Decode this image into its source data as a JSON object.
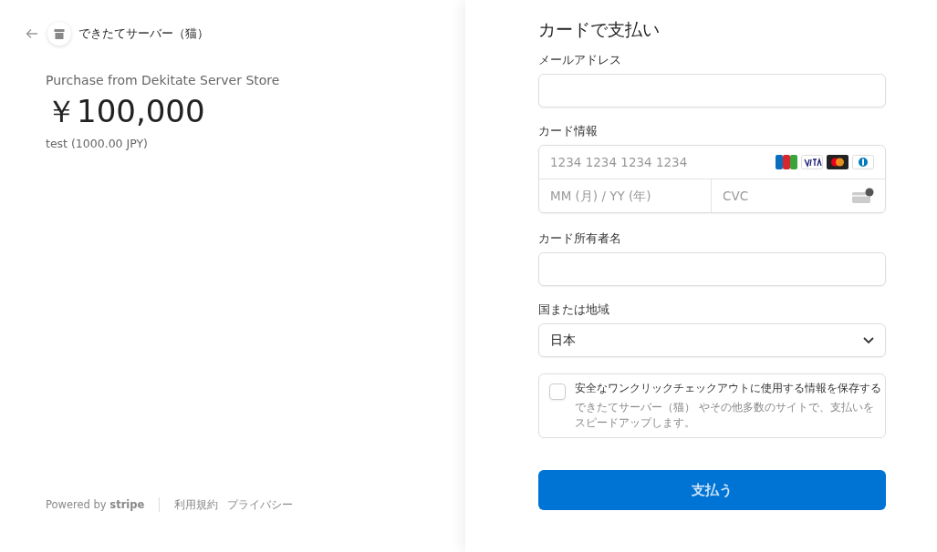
{
  "merchant": {
    "name": "できたてサーバー（猫）"
  },
  "summary": {
    "title": "Purchase from Dekitate Server Store",
    "amount": "￥100,000",
    "detail": "test (1000.00 JPY)"
  },
  "footer": {
    "powered": "Powered by **stripe**",
    "links": [
      "利用規約",
      "プライバシー"
    ]
  },
  "form": {
    "title": "カードで支払い",
    "email": {
      "label": "メールアドレス"
    },
    "card": {
      "label": "カード情報",
      "number_placeholder": "1234 1234 1234 1234",
      "expiry_placeholder": "MM (月) / YY (年)",
      "cvc_placeholder": "CVC"
    },
    "holder": {
      "label": "カード所有者名"
    },
    "country": {
      "label": "国または地域",
      "value": "日本"
    },
    "save": {
      "checked": false,
      "label": "安全なワンクリックチェックアウトに使用する情報を保存する",
      "description": "できたてサーバー（猫） やその他多数のサイトで、支払いをスピードアップします。"
    },
    "submit": {
      "label": "支払う"
    }
  }
}
